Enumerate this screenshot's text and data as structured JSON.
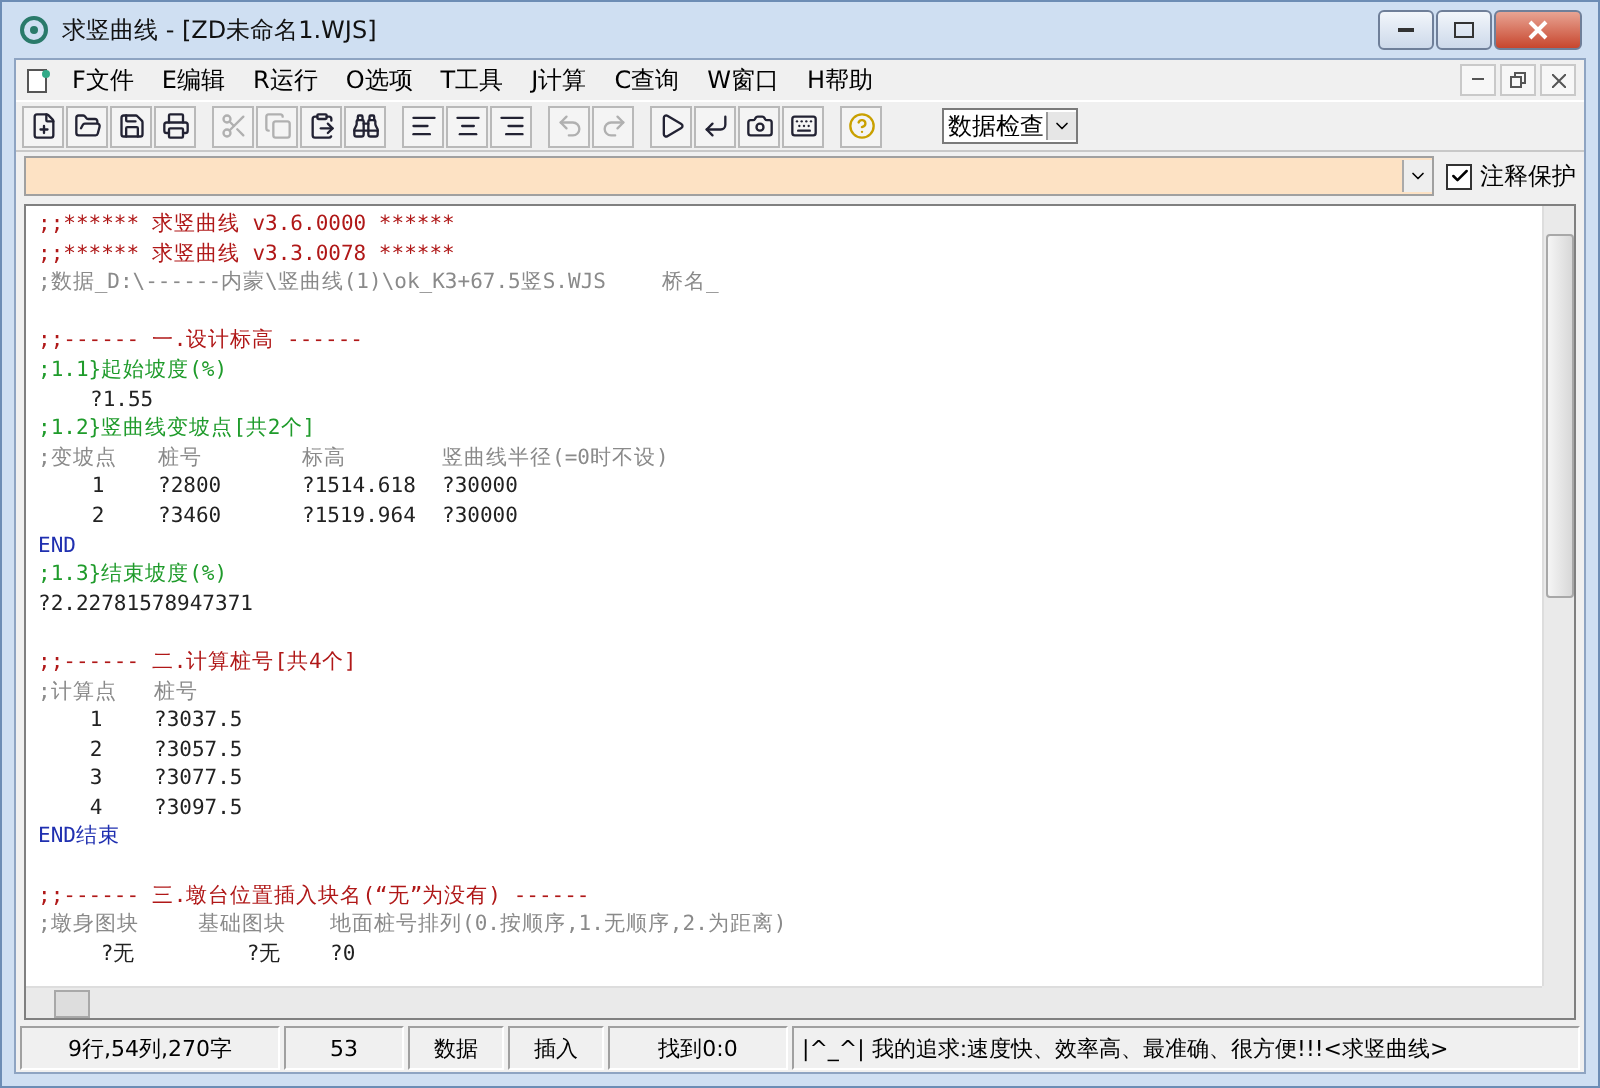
{
  "window": {
    "title": "求竖曲线 - [ZD未命名1.WJS]"
  },
  "menu": [
    "F文件",
    "E编辑",
    "R运行",
    "O选项",
    "T工具",
    "J计算",
    "C查询",
    "W窗口",
    "H帮助"
  ],
  "toolbar": {
    "groups": [
      [
        {
          "disabled": false
        },
        {
          "disabled": false
        },
        {
          "disabled": false
        },
        {
          "disabled": false
        }
      ],
      [
        {
          "disabled": true
        },
        {
          "disabled": true
        },
        {
          "disabled": false
        },
        {
          "disabled": false
        }
      ],
      [
        {
          "disabled": false
        },
        {
          "disabled": false
        },
        {
          "disabled": false
        }
      ],
      [
        {
          "disabled": true
        },
        {
          "disabled": true
        }
      ],
      [
        {
          "disabled": false
        },
        {
          "disabled": false
        },
        {
          "disabled": false
        },
        {
          "disabled": false
        }
      ],
      [
        {
          "disabled": false
        }
      ]
    ],
    "dropdown": "数据检查"
  },
  "comment_bar": {
    "protect": {
      "label": "注释保护",
      "checked": true
    }
  },
  "editor": {
    "lines": [
      {
        "kind": "title",
        "text": ";;****** 求竖曲线 v3.6.0000 ******"
      },
      {
        "kind": "title",
        "text": ";;****** 求竖曲线 v3.3.0078 ******"
      },
      {
        "kind": "note",
        "text": ";数据_D:\\------内蒙\\竖曲线(1)\\ok_K3+67.5竖S.WJS",
        "extra": "桥名_"
      },
      {
        "kind": "blank"
      },
      {
        "kind": "title",
        "text": ";;------ 一.设计标高 ------"
      },
      {
        "kind": "section",
        "text": ";1.1}起始坡度(%)"
      },
      {
        "kind": "value",
        "text": "?1.55",
        "indent": true
      },
      {
        "kind": "section",
        "text": ";1.2}竖曲线变坡点[共2个]"
      },
      {
        "kind": "table",
        "columns": [
          ";变坡点",
          "桩号",
          "标高",
          "竖曲线半径(=0时不设)"
        ],
        "rows": [
          [
            "1",
            "?2800",
            "?1514.618",
            "?30000"
          ],
          [
            "2",
            "?3460",
            "?1519.964",
            "?30000"
          ]
        ]
      },
      {
        "kind": "end",
        "text": "END"
      },
      {
        "kind": "section",
        "text": ";1.3}结束坡度(%)"
      },
      {
        "kind": "value",
        "text": "?2.22781578947371",
        "indent": false
      },
      {
        "kind": "blank"
      },
      {
        "kind": "title",
        "text": ";;------ 二.计算桩号[共4个]"
      },
      {
        "kind": "table",
        "columns": [
          ";计算点",
          "桩号"
        ],
        "rows": [
          [
            "1",
            "?3037.5"
          ],
          [
            "2",
            "?3057.5"
          ],
          [
            "3",
            "?3077.5"
          ],
          [
            "4",
            "?3097.5"
          ]
        ]
      },
      {
        "kind": "end",
        "text": "END结束"
      },
      {
        "kind": "blank"
      },
      {
        "kind": "title",
        "text": ";;------ 三.墩台位置插入块名(“无”为没有) ------"
      },
      {
        "kind": "table",
        "columns": [
          ";墩身图块",
          "基础图块",
          "地面桩号排列(0.按顺序,1.无顺序,2.为距离)"
        ],
        "rows": [
          [
            "?无",
            "?无",
            "?0"
          ]
        ]
      }
    ]
  },
  "status_bar": [
    "9行,54列,270字",
    "53",
    "数据",
    "插入",
    "找到0:0",
    "|^_^| 我的追求:速度快、效率高、最准确、很方便!!!<求竖曲线>"
  ]
}
